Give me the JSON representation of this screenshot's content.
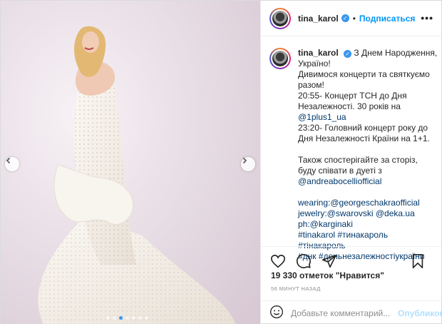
{
  "post": {
    "username": "tina_karol",
    "follow_label": "Подписаться",
    "separator": "•",
    "more_label": "•••",
    "caption": {
      "username": "tina_karol",
      "lines": [
        "З Днем Народження,",
        "Україно!",
        "Дивимося концерти та святкуємо",
        "разом!",
        "20:55- Концерт ТСН до Дня",
        "Незалежності. 30 років на",
        "@1plus1_ua",
        "23:20- Головний концерт року до",
        "Дня Незалежності Країни на 1+1.",
        "",
        "Також спостерігайте за сторіз,",
        "буду співати в дуеті з",
        "@andreabocelliofficial",
        "",
        "wearing:@georgeschakraofficial",
        "jewelry:@swarovski @deka.ua",
        "ph:@karginaki",
        "#tinakarol #тинакароль #тінакароль",
        "#днк #деньнезалежностіукраїни"
      ]
    },
    "likes_text": "19 330 отметок \"Нравится\"",
    "time_text": "56 МИНУТ НАЗАД",
    "comment_placeholder": "Добавьте комментарий...",
    "publish_label": "Опубликовать",
    "carousel": {
      "slides": 7,
      "active_index": 2
    },
    "icons": {
      "prev": "chevron-left-icon",
      "next": "chevron-right-icon",
      "like": "heart-icon",
      "comment": "comment-icon",
      "share": "share-icon",
      "save": "bookmark-icon",
      "emoji": "emoji-icon",
      "verified": "verified-badge-icon"
    },
    "colors": {
      "accent": "#0095f6",
      "verified": "#3897f0",
      "publish_disabled": "#b2dffc"
    }
  }
}
